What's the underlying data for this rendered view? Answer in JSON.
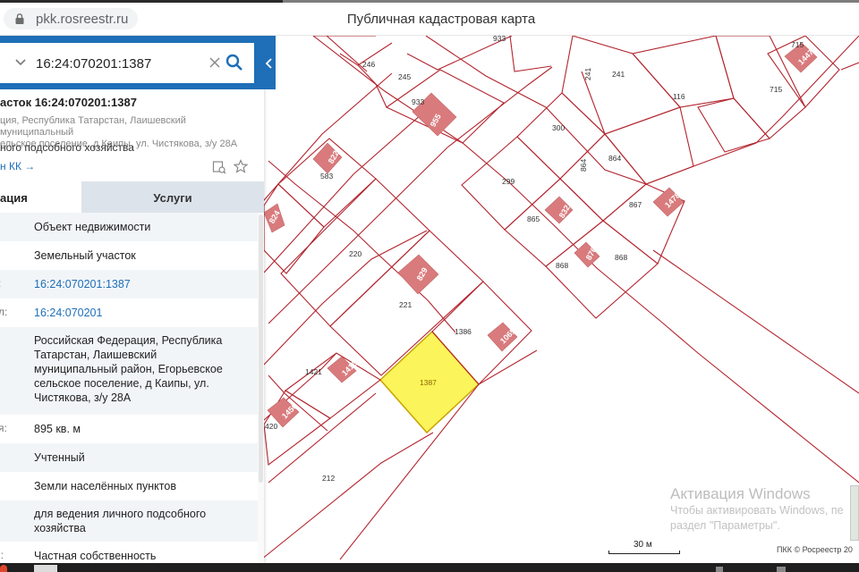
{
  "browser": {
    "url": "pkk.rosreestr.ru",
    "page_title": "Публичная кадастровая карта",
    "lock_icon": "lock-icon"
  },
  "search": {
    "value": "16:24:070201:1387",
    "icons": [
      "chevron-down-icon",
      "close-icon",
      "search-icon",
      "chevron-left-icon"
    ]
  },
  "object": {
    "title": "асток 16:24:070201:1387",
    "address_lines": [
      "ция, Республика Татарстан, Лаишевский муниципальный",
      "ельское поселение, д Каипы, ул. Чистякова, з/у 28А"
    ],
    "use": "ного подсобного хозяйства",
    "cc_link": "н КК →",
    "icons": [
      "bookmark-search-icon",
      "star-icon"
    ]
  },
  "tabs": {
    "info": "ация",
    "services": "Услуги"
  },
  "rows": [
    {
      "label": "",
      "value": "Объект недвижимости"
    },
    {
      "label": "",
      "value": "Земельный участок"
    },
    {
      "label": ":",
      "value": "16:24:070201:1387"
    },
    {
      "label": "л:",
      "value": "16:24:070201"
    },
    {
      "label": "",
      "value_lines": [
        "Российская Федерация, Республика",
        "Татарстан, Лаишевский",
        "муниципальный район, Егорьевское",
        "сельское поселение, д Каипы, ул.",
        "Чистякова, з/у 28А"
      ]
    },
    {
      "label": "я:",
      "value": "895 кв. м"
    },
    {
      "label": "",
      "value": "Учтенный"
    },
    {
      "label": "",
      "value": "Земли населённых пунктов"
    },
    {
      "label": "",
      "value_lines": [
        "для ведения личного подсобного",
        "хозяйства"
      ]
    },
    {
      "label": "i:",
      "value": "Частная собственность"
    }
  ],
  "map": {
    "parcel_labels": [
      "933",
      "246",
      "245",
      "241",
      "241",
      "116",
      "715",
      "715",
      "300",
      "299",
      "864",
      "864",
      "867",
      "865",
      "868",
      "868",
      "220",
      "221",
      "583",
      "1386",
      "1387",
      "1421",
      "420",
      "212"
    ],
    "building_labels": [
      "955",
      "822",
      "824",
      "832",
      "876",
      "1478",
      "1447",
      "829",
      "1065",
      "1416",
      "1450"
    ],
    "colors": {
      "parcel_border": "#b3242e",
      "building_fill": "#d97b7d",
      "selected_fill": "#fbf45a",
      "selected_border": "#c8a800"
    }
  },
  "overlays": {
    "watermark_title": "Активация Windows",
    "watermark_line1": "Чтобы активировать Windows, пе",
    "watermark_line2": "раздел \"Параметры\".",
    "scale_label": "30 м",
    "copyright": "ПКК © Росреестр 20"
  },
  "colors": {
    "accent": "#1e6fb7",
    "tab_inactive": "#dde3ea"
  }
}
